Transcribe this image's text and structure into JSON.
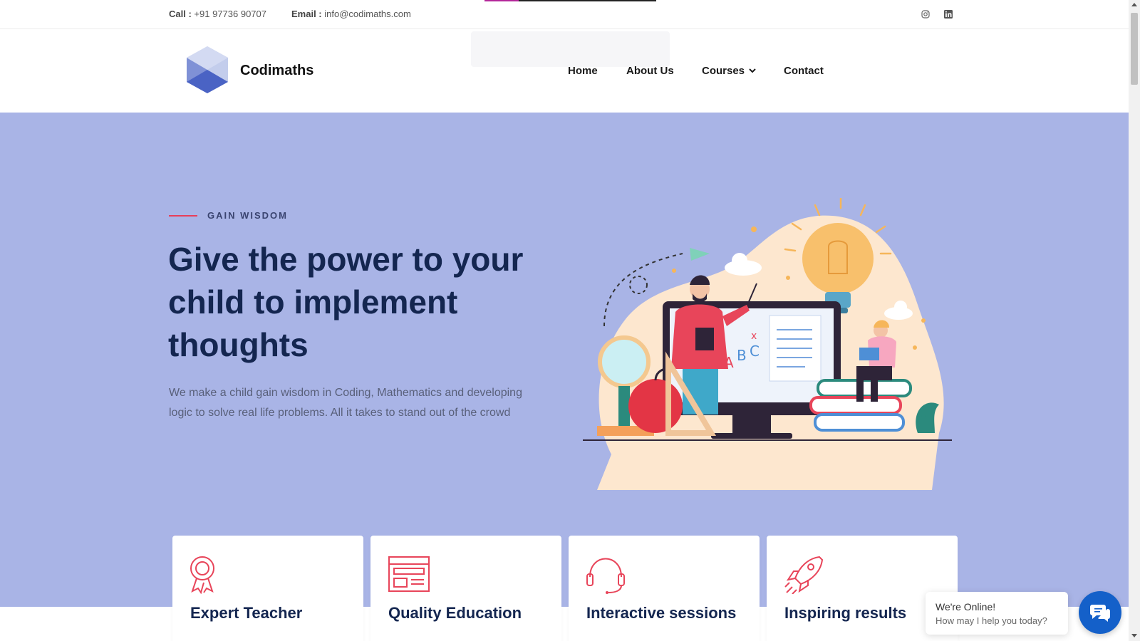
{
  "topbar": {
    "call_label": "Call :",
    "call_value": "+91 97736 90707",
    "email_label": "Email :",
    "email_value": "info@codimaths.com"
  },
  "social": {
    "instagram": "instagram-icon",
    "linkedin": "linkedin-icon"
  },
  "header": {
    "brand": "Codimaths",
    "nav": [
      {
        "label": "Home"
      },
      {
        "label": "About Us"
      },
      {
        "label": "Courses"
      },
      {
        "label": "Contact"
      }
    ]
  },
  "hero": {
    "eyebrow": "GAIN WISDOM",
    "headline": "Give the power to your child to implement thoughts",
    "lead": "We make a child gain wisdom in Coding, Mathematics and developing logic to solve real life problems. All it takes to stand out of the crowd"
  },
  "cards": [
    {
      "title": "Expert Teacher",
      "icon": "award-ribbon-icon"
    },
    {
      "title": "Quality Education",
      "icon": "layout-document-icon"
    },
    {
      "title": "Interactive sessions",
      "icon": "headset-icon"
    },
    {
      "title": "Inspiring results",
      "icon": "rocket-icon"
    }
  ],
  "chat": {
    "line1": "We're Online!",
    "line2": "How may I help you today?"
  },
  "colors": {
    "hero_bg": "#a9b4e6",
    "accent": "#e83e5a",
    "heading": "#142650",
    "chat": "#1460c9"
  }
}
